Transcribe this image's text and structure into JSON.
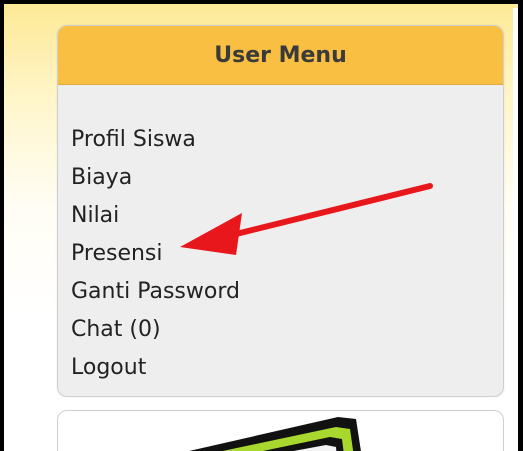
{
  "user_menu": {
    "title": "User Menu",
    "items": [
      {
        "label": "Profil Siswa"
      },
      {
        "label": "Biaya"
      },
      {
        "label": "Nilai"
      },
      {
        "label": "Presensi"
      },
      {
        "label": "Ganti Password"
      },
      {
        "label": "Chat (0)"
      },
      {
        "label": "Logout"
      }
    ]
  },
  "annotation": {
    "arrow_color": "#e8171c",
    "points_to": "Presensi"
  },
  "colors": {
    "header": "#f9bf43",
    "panel": "#eeeeee",
    "logo_green": "#a8d82d"
  }
}
